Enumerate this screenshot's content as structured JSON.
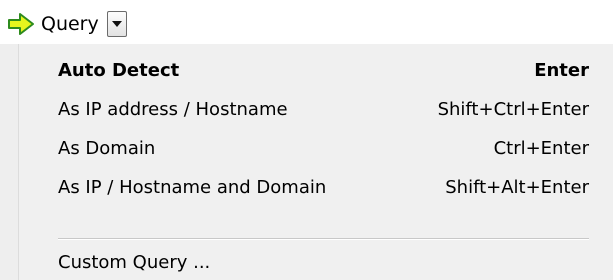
{
  "toolbar": {
    "query_label": "Query",
    "query_icon": "green-arrow-right-icon",
    "dropdown_icon": "chevron-down-icon"
  },
  "menu": {
    "items": [
      {
        "label": "Auto Detect",
        "shortcut": "Enter",
        "bold": true
      },
      {
        "label": "As IP address / Hostname",
        "shortcut": "Shift+Ctrl+Enter"
      },
      {
        "label": "As Domain",
        "shortcut": "Ctrl+Enter"
      },
      {
        "label": "As IP / Hostname and Domain",
        "shortcut": "Shift+Alt+Enter"
      }
    ],
    "custom": {
      "label": "Custom Query ...",
      "shortcut": ""
    }
  },
  "colors": {
    "arrow_fill": "#e6f51e",
    "arrow_stroke": "#2e8b1e",
    "menu_background": "#f0f0f0"
  }
}
